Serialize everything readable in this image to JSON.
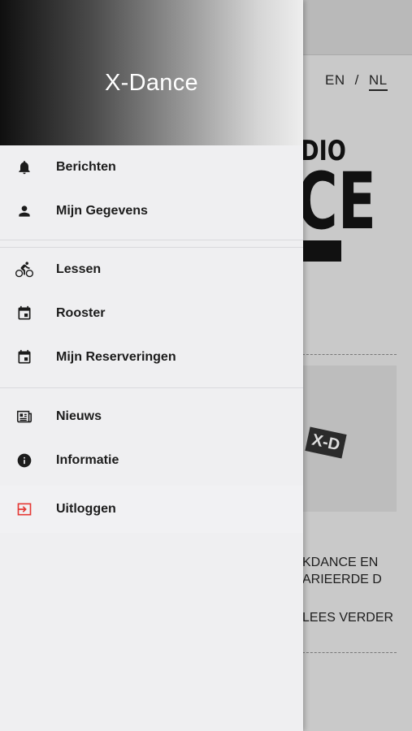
{
  "drawer": {
    "title": "X-Dance",
    "sections": [
      {
        "items": [
          {
            "label": "Berichten",
            "icon": "bell-icon"
          },
          {
            "label": "Mijn Gegevens",
            "icon": "person-icon"
          }
        ]
      },
      {
        "items": [
          {
            "label": "Lessen",
            "icon": "bicycle-icon"
          },
          {
            "label": "Rooster",
            "icon": "calendar-icon"
          },
          {
            "label": "Mijn Reserveringen",
            "icon": "calendar-event-icon"
          }
        ]
      },
      {
        "items": [
          {
            "label": "Nieuws",
            "icon": "newspaper-icon"
          },
          {
            "label": "Informatie",
            "icon": "info-icon"
          }
        ]
      }
    ],
    "logout": {
      "label": "Uitloggen",
      "icon": "logout-icon",
      "color": "#e53935"
    }
  },
  "background": {
    "language": {
      "en": "EN",
      "separator": "/",
      "nl": "NL",
      "selected": "NL"
    },
    "logo": {
      "top_text": "DIO",
      "big_text": "CE"
    },
    "card_logo_text": "X-D",
    "article": {
      "line1": "KDANCE EN",
      "line2": "ARIEERDE D",
      "read_more": "LEES VERDER"
    }
  }
}
